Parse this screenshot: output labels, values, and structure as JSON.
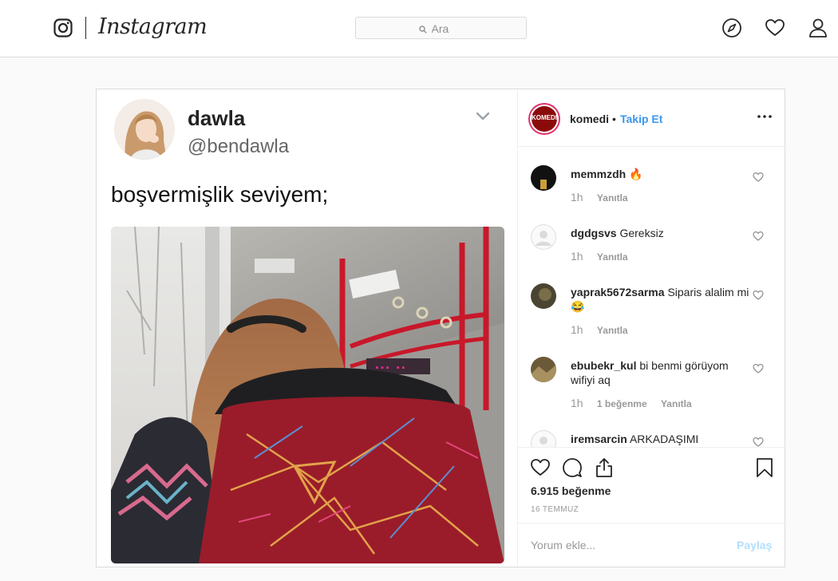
{
  "header": {
    "wordmark": "Instagram",
    "search_placeholder": "Ara",
    "icons": [
      "instagram-glyph-icon",
      "search-icon",
      "explore-compass-icon",
      "activity-heart-icon",
      "profile-person-icon"
    ]
  },
  "tweet": {
    "display_name": "dawla",
    "handle": "@bendawla",
    "text": "boşvermişlik seviyem;"
  },
  "post": {
    "account": "komedi",
    "separator": "•",
    "follow_label": "Takip Et",
    "avatar_text": "KOMEDI",
    "comments": [
      {
        "user": "memmzdh",
        "text": "🔥",
        "time": "1h",
        "likes": "",
        "reply": "Yanıtla"
      },
      {
        "user": "dgdgsvs",
        "text": "Gereksiz",
        "time": "1h",
        "likes": "",
        "reply": "Yanıtla"
      },
      {
        "user": "yaprak5672sarma",
        "text": "Siparis alalim mi😂",
        "time": "1h",
        "likes": "",
        "reply": "Yanıtla"
      },
      {
        "user": "ebubekr_kul",
        "text": "bi benmi görüyom wifiyi aq",
        "time": "1h",
        "likes": "1 beğenme",
        "reply": "Yanıtla"
      },
      {
        "user": "iremsarcin",
        "text": "ARKADAŞIMI",
        "time": "",
        "likes": "",
        "reply": ""
      }
    ],
    "likes_label": "6.915 beğenme",
    "date_label": "16 TEMMUZ",
    "comment_placeholder": "Yorum ekle...",
    "share_label": "Paylaş"
  },
  "colors": {
    "accent": "#3897f0",
    "share_disabled": "#b2dffc",
    "border": "#dbdbdb",
    "story_ring": "#e1306c"
  }
}
